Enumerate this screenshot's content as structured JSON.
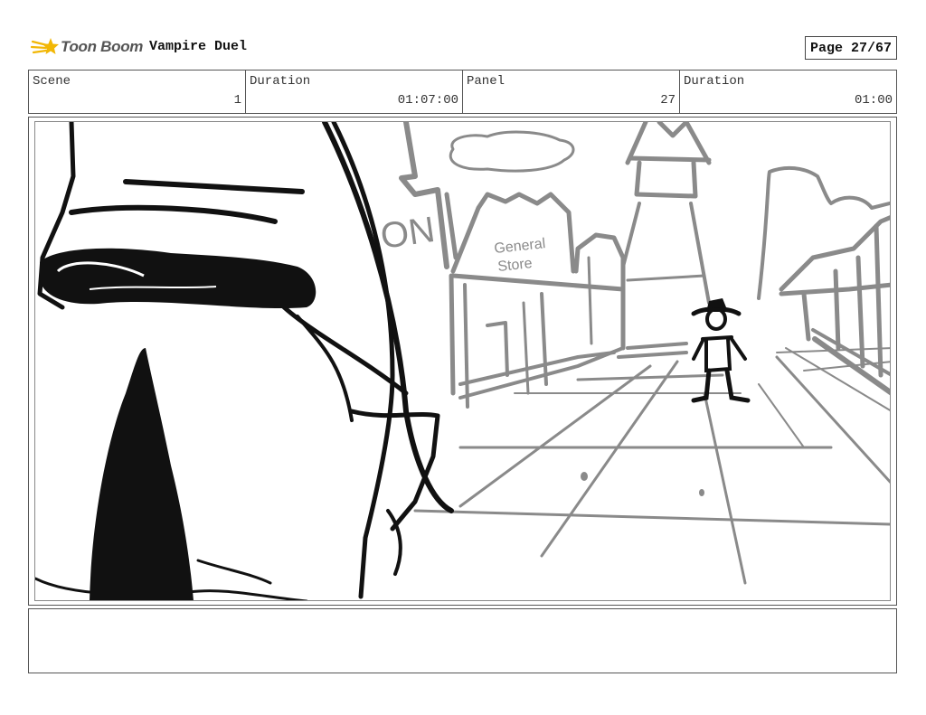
{
  "header": {
    "logo_text": "Toon Boom",
    "logo_icon": "toon-boom-star-icon",
    "brand_color": "#f2b705",
    "project_title": "Vampire Duel",
    "page_label": "Page 27/67"
  },
  "info": {
    "scene_label": "Scene",
    "scene_value": "1",
    "scene_duration_label": "Duration",
    "scene_duration_value": "01:07:00",
    "panel_label": "Panel",
    "panel_value": "27",
    "panel_duration_label": "Duration",
    "panel_duration_value": "01:00"
  },
  "panel": {
    "sign_text_line1": "General",
    "sign_text_line2": "Store",
    "building_sign_text": "ON"
  },
  "notes": {
    "text": ""
  }
}
